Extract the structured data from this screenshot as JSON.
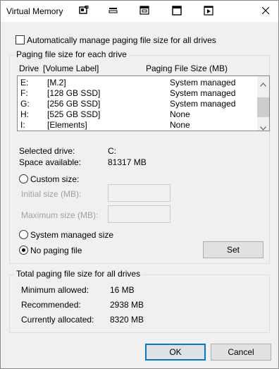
{
  "window": {
    "title": "Virtual Memory",
    "titlebar_icons": [
      "window-icon",
      "taskbar-icon",
      "monitor-icon",
      "window-frame-icon",
      "media-icon"
    ]
  },
  "auto_manage": {
    "label": "Automatically manage paging file size for all drives",
    "checked": false
  },
  "drives_group": {
    "title": "Paging file size for each drive",
    "col_drive": "Drive",
    "col_volume": "[Volume Label]",
    "col_size": "Paging File Size (MB)",
    "rows": [
      {
        "drive": "E:",
        "label": "[M.2]",
        "size": "System managed"
      },
      {
        "drive": "F:",
        "label": "[128 GB SSD]",
        "size": "System managed"
      },
      {
        "drive": "G:",
        "label": "[256 GB SSD]",
        "size": "System managed"
      },
      {
        "drive": "H:",
        "label": "[525 GB SSD]",
        "size": "None"
      },
      {
        "drive": "I:",
        "label": "[Elements]",
        "size": "None"
      }
    ],
    "selected_drive_label": "Selected drive:",
    "selected_drive_value": "C:",
    "space_available_label": "Space available:",
    "space_available_value": "81317 MB",
    "custom_size_label": "Custom size:",
    "initial_size_label": "Initial size (MB):",
    "initial_size_value": "",
    "maximum_size_label": "Maximum size (MB):",
    "maximum_size_value": "",
    "system_managed_label": "System managed size",
    "no_paging_label": "No paging file",
    "selected_option": "no_paging",
    "set_button": "Set"
  },
  "totals_group": {
    "title": "Total paging file size for all drives",
    "minimum_label": "Minimum allowed:",
    "minimum_value": "16 MB",
    "recommended_label": "Recommended:",
    "recommended_value": "2938 MB",
    "allocated_label": "Currently allocated:",
    "allocated_value": "8320 MB"
  },
  "buttons": {
    "ok": "OK",
    "cancel": "Cancel"
  },
  "colors": {
    "accent": "#0078d7",
    "background": "#f0f0f0"
  }
}
